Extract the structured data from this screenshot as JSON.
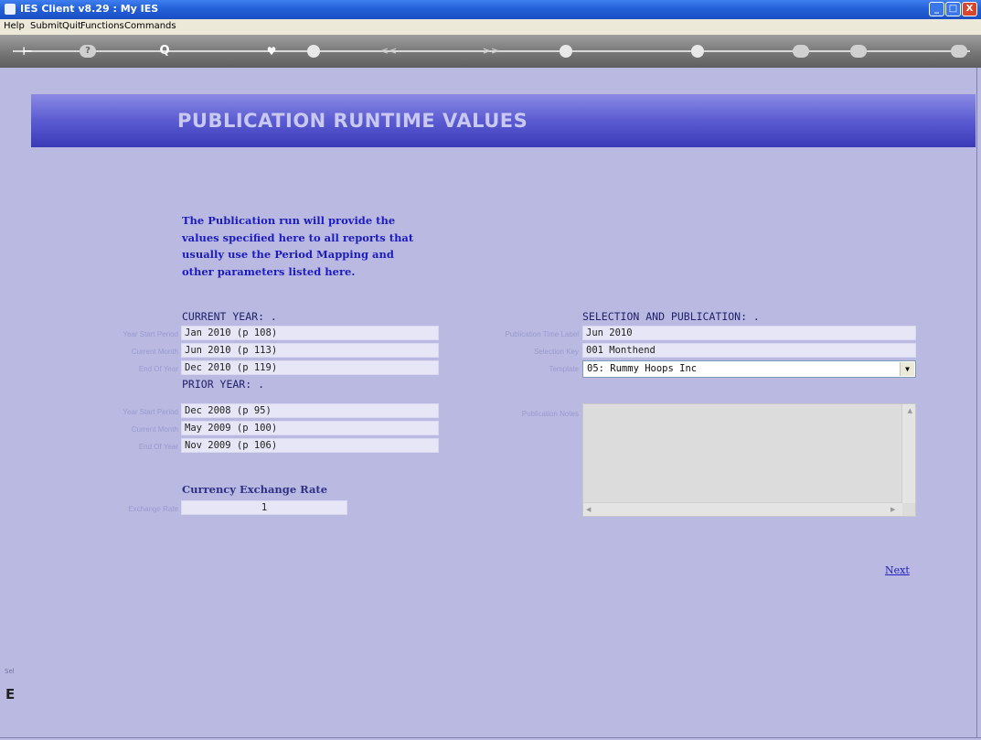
{
  "window": {
    "title": "IES Client v8.29 : My IES",
    "min": "_",
    "max": "□",
    "close": "X"
  },
  "menu": [
    "Help",
    "Submit",
    "Quit",
    "Functions",
    "Commands"
  ],
  "toolbar": {
    "q_label": "?",
    "search_label": "Q",
    "back_label": "<<",
    "fwd_label": ">>"
  },
  "banner": {
    "heading": "PUBLICATION RUNTIME VALUES"
  },
  "intro": "The Publication run will provide the values specified here to all reports that usually use the Period Mapping and other parameters listed here.",
  "current_year": {
    "heading": "CURRENT YEAR: .",
    "fields": [
      {
        "label": "Year Start Period",
        "value": "Jan 2010 (p 108)"
      },
      {
        "label": "Current Month",
        "value": "Jun 2010 (p 113)"
      },
      {
        "label": "End Of Year",
        "value": "Dec 2010 (p 119)"
      }
    ]
  },
  "prior_year": {
    "heading": "PRIOR YEAR: .",
    "fields": [
      {
        "label": "Year Start Period",
        "value": "Dec 2008 (p 95)"
      },
      {
        "label": "Current Month",
        "value": "May 2009 (p 100)"
      },
      {
        "label": "End Of Year",
        "value": "Nov 2009 (p 106)"
      }
    ]
  },
  "exchange": {
    "heading": "Currency Exchange Rate",
    "label": "Exchange Rate",
    "value": "1"
  },
  "selection": {
    "heading": "SELECTION AND PUBLICATION: .",
    "pub_time_label": "Publication Time Label",
    "pub_time_value": "Jun 2010",
    "sel_key_label": "Selection Key",
    "sel_key_value": "001 Monthend",
    "template_label": "Template",
    "template_value": "05: Rummy Hoops Inc",
    "template_arrow": "▼",
    "notes_label": "Publication Notes"
  },
  "next": "Next",
  "left_strip": {
    "s1": "Sel",
    "s2": "E"
  }
}
